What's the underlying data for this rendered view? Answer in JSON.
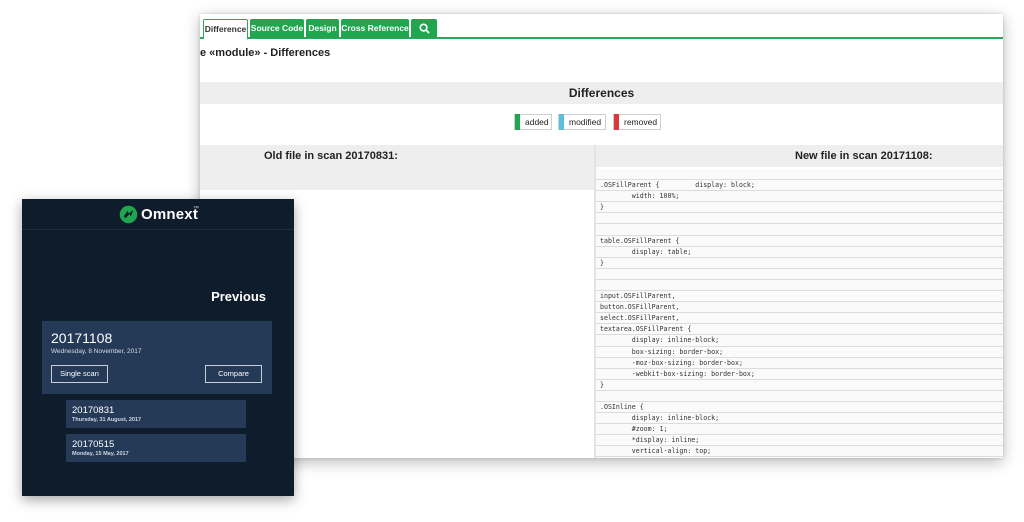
{
  "diff": {
    "tabs": [
      {
        "label": "Difference",
        "active": true
      },
      {
        "label": "Source Code"
      },
      {
        "label": "Design"
      },
      {
        "label": "Cross Reference"
      }
    ],
    "search_icon": "search-icon",
    "page_heading": "e «module» - Differences",
    "section_title": "Differences",
    "legend": [
      {
        "label": "added",
        "color": "#1fa64f"
      },
      {
        "label": "modified",
        "color": "#5bc0de"
      },
      {
        "label": "removed",
        "color": "#d9393a"
      }
    ],
    "old_file_label": "Old file in scan 20170831:",
    "new_file_label": "New file in scan 20171108:",
    "new_code_lines": [
      "",
      ".OSFillParent {         display: block;",
      "        width: 100%;",
      "}",
      "",
      "",
      "table.OSFillParent {",
      "        display: table;",
      "}",
      "",
      "",
      "input.OSFillParent,",
      "button.OSFillParent,",
      "select.OSFillParent,",
      "textarea.OSFillParent {",
      "        display: inline-block;",
      "        box-sizing: border-box;",
      "        -moz-box-sizing: border-box;",
      "        -webkit-box-sizing: border-box;",
      "}",
      "",
      ".OSInline {",
      "        display: inline-block;",
      "        #zoom: 1;",
      "        *display: inline;",
      "        vertical-align: top;",
      "}",
      ""
    ]
  },
  "omnext": {
    "brand": "Omnext",
    "brand_mark": "™",
    "previous_title": "Previous",
    "current_scan": {
      "id": "20171108",
      "date": "Wednesday, 8 November, 2017",
      "single_scan_label": "Single scan",
      "compare_label": "Compare"
    },
    "previous_scans": [
      {
        "id": "20170831",
        "date": "Thursday, 31 August, 2017"
      },
      {
        "id": "20170515",
        "date": "Monday, 15 May, 2017"
      }
    ]
  }
}
